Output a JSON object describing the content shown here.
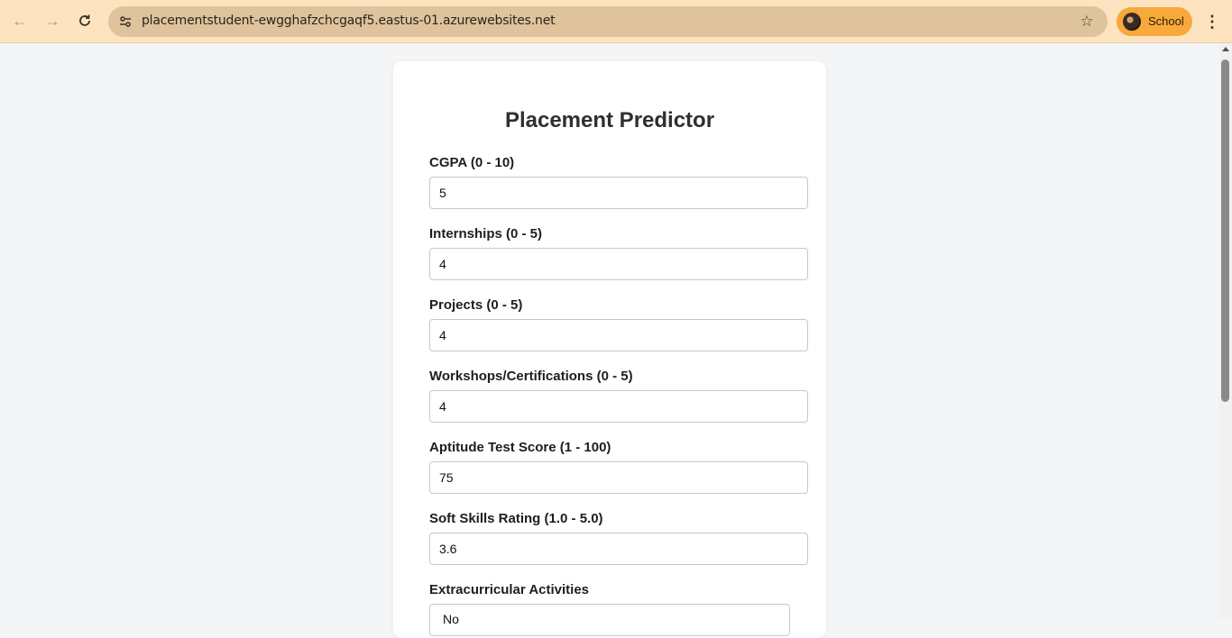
{
  "browser": {
    "url": "placementstudent-ewgghafzchcgaqf5.eastus-01.azurewebsites.net",
    "profile_name": "School",
    "icons": [
      "back-arrow-icon",
      "forward-arrow-icon",
      "reload-icon",
      "site-info-icon",
      "star-icon",
      "kebab-menu-icon"
    ]
  },
  "form": {
    "title": "Placement Predictor",
    "fields": [
      {
        "label": "CGPA (0 - 10)",
        "value": "5"
      },
      {
        "label": "Internships (0 - 5)",
        "value": "4"
      },
      {
        "label": "Projects (0 - 5)",
        "value": "4"
      },
      {
        "label": "Workshops/Certifications (0 - 5)",
        "value": "4"
      },
      {
        "label": "Aptitude Test Score (1 - 100)",
        "value": "75"
      },
      {
        "label": "Soft Skills Rating (1.0 - 5.0)",
        "value": "3.6"
      }
    ],
    "extracurricular": {
      "label": "Extracurricular Activities",
      "value": "No"
    }
  },
  "colors": {
    "browser_bar": "#fde3c0",
    "omnibox": "#dfc39c",
    "profile_chip": "#f7a93b",
    "page_background": "#f4f5f7",
    "card": "#ffffff"
  }
}
